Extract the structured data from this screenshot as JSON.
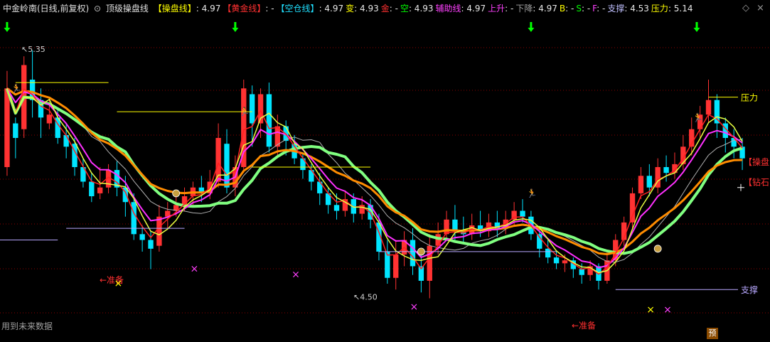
{
  "header": {
    "stock_name": "中金岭南(日线,前复权)",
    "indicator_name": "顶级操盘线",
    "items": [
      {
        "label": "【操盘线】",
        "value": ": 4.97",
        "color": "#ffff00"
      },
      {
        "label": "【黄金线】",
        "value": ": -",
        "color": "#ff3030"
      },
      {
        "label": "【空仓线】",
        "value": ": 4.97",
        "color": "#20e0ff"
      },
      {
        "label": "变",
        "value": ": 4.93",
        "color": "#ffff00"
      },
      {
        "label": "金",
        "value": ": -",
        "color": "#ff3030"
      },
      {
        "label": "空",
        "value": ": 4.93",
        "color": "#00ff00"
      },
      {
        "label": "辅助线",
        "value": ": 4.97",
        "color": "#ff40ff"
      },
      {
        "label": "上升",
        "value": ": -",
        "color": "#ff40ff"
      },
      {
        "label": "下降",
        "value": ": 4.97",
        "color": "#a0a0a0"
      },
      {
        "label": "B",
        "value": ": -",
        "color": "#ffff00"
      },
      {
        "label": "S",
        "value": ": -",
        "color": "#00ff00"
      },
      {
        "label": "F",
        "value": ": -",
        "color": "#ff40ff"
      },
      {
        "label": "支撑",
        "value": ": 4.53",
        "color": "#c0c0ff"
      },
      {
        "label": "压力",
        "value": ": 5.14",
        "color": "#ffff00"
      }
    ],
    "settings_icon": "diamond-icon",
    "close_icon": "close-icon"
  },
  "footer_note": "用到未来数据",
  "badge": "预",
  "colors": {
    "up": "#ff3232",
    "down": "#00e5ff",
    "ma_thin": "#ff2020",
    "ma_pink": "#ff30ff",
    "ma_orange": "#ff8c00",
    "ma_green": "#80ff80",
    "ma_yellow": "#e8ff40",
    "ma_gray": "#b0b0b0",
    "support": "#b8a8ff",
    "resistance": "#ffff00",
    "grid": "#8b0000"
  },
  "chart_data": {
    "type": "candlestick",
    "y_range": [
      4.45,
      5.45
    ],
    "annotations": {
      "high_label": "5.35",
      "low_label": "4.50",
      "prepare_label": "←准备",
      "resistance_label": "压力",
      "support_label": "支撑",
      "right_labels": [
        "【操盘",
        "【钻石"
      ]
    },
    "candles": [
      [
        4.95,
        5.22,
        5.28,
        4.92
      ],
      [
        5.1,
        5.05,
        5.12,
        4.98
      ],
      [
        5.08,
        5.3,
        5.33,
        5.05
      ],
      [
        5.25,
        5.18,
        5.35,
        5.12
      ],
      [
        5.18,
        5.12,
        5.22,
        5.05
      ],
      [
        5.1,
        5.13,
        5.18,
        5.08
      ],
      [
        5.12,
        5.05,
        5.15,
        5.03
      ],
      [
        5.06,
        5.02,
        5.1,
        4.98
      ],
      [
        5.03,
        4.95,
        5.05,
        4.92
      ],
      [
        4.95,
        4.9,
        4.98,
        4.88
      ],
      [
        4.9,
        4.85,
        4.93,
        4.83
      ],
      [
        4.86,
        4.88,
        4.95,
        4.84
      ],
      [
        4.88,
        4.94,
        4.96,
        4.86
      ],
      [
        4.94,
        4.88,
        4.97,
        4.85
      ],
      [
        4.88,
        4.83,
        4.92,
        4.78
      ],
      [
        4.83,
        4.72,
        4.86,
        4.7
      ],
      [
        4.72,
        4.7,
        4.75,
        4.66
      ],
      [
        4.7,
        4.67,
        4.73,
        4.6
      ],
      [
        4.68,
        4.78,
        4.82,
        4.66
      ],
      [
        4.78,
        4.8,
        4.83,
        4.74
      ],
      [
        4.8,
        4.82,
        4.86,
        4.78
      ],
      [
        4.82,
        4.85,
        4.88,
        4.8
      ],
      [
        4.85,
        4.88,
        4.9,
        4.82
      ],
      [
        4.88,
        4.86,
        4.92,
        4.83
      ],
      [
        4.86,
        4.9,
        4.94,
        4.84
      ],
      [
        4.9,
        5.05,
        5.1,
        4.88
      ],
      [
        5.03,
        4.88,
        5.08,
        4.86
      ],
      [
        4.88,
        4.95,
        4.99,
        4.85
      ],
      [
        4.95,
        5.22,
        5.25,
        4.93
      ],
      [
        5.2,
        5.1,
        5.23,
        5.02
      ],
      [
        5.1,
        5.2,
        5.22,
        5.05
      ],
      [
        5.2,
        5.02,
        5.24,
        5.0
      ],
      [
        5.02,
        5.09,
        5.13,
        4.98
      ],
      [
        5.09,
        5.04,
        5.11,
        4.99
      ],
      [
        5.03,
        4.98,
        5.06,
        4.96
      ],
      [
        4.98,
        4.94,
        5.0,
        4.91
      ],
      [
        4.94,
        4.9,
        4.96,
        4.87
      ],
      [
        4.9,
        4.86,
        4.93,
        4.82
      ],
      [
        4.86,
        4.82,
        4.88,
        4.79
      ],
      [
        4.82,
        4.8,
        4.86,
        4.77
      ],
      [
        4.8,
        4.84,
        4.87,
        4.78
      ],
      [
        4.84,
        4.79,
        4.86,
        4.76
      ],
      [
        4.79,
        4.82,
        4.85,
        4.77
      ],
      [
        4.82,
        4.77,
        4.84,
        4.74
      ],
      [
        4.76,
        4.66,
        4.79,
        4.63
      ],
      [
        4.66,
        4.57,
        4.7,
        4.55
      ],
      [
        4.57,
        4.65,
        4.7,
        4.53
      ],
      [
        4.65,
        4.7,
        4.73,
        4.61
      ],
      [
        4.7,
        4.61,
        4.74,
        4.58
      ],
      [
        4.61,
        4.56,
        4.65,
        4.52
      ],
      [
        4.56,
        4.68,
        4.72,
        4.5
      ],
      [
        4.68,
        4.72,
        4.76,
        4.65
      ],
      [
        4.72,
        4.77,
        4.8,
        4.7
      ],
      [
        4.77,
        4.73,
        4.82,
        4.7
      ],
      [
        4.73,
        4.72,
        4.78,
        4.69
      ],
      [
        4.72,
        4.75,
        4.79,
        4.7
      ],
      [
        4.75,
        4.73,
        4.8,
        4.71
      ],
      [
        4.73,
        4.76,
        4.79,
        4.71
      ],
      [
        4.76,
        4.74,
        4.8,
        4.71
      ],
      [
        4.74,
        4.77,
        4.8,
        4.72
      ],
      [
        4.77,
        4.8,
        4.83,
        4.75
      ],
      [
        4.8,
        4.78,
        4.84,
        4.76
      ],
      [
        4.78,
        4.72,
        4.8,
        4.7
      ],
      [
        4.72,
        4.67,
        4.74,
        4.64
      ],
      [
        4.67,
        4.64,
        4.7,
        4.62
      ],
      [
        4.64,
        4.62,
        4.66,
        4.6
      ],
      [
        4.62,
        4.63,
        4.65,
        4.59
      ],
      [
        4.63,
        4.6,
        4.64,
        4.57
      ],
      [
        4.6,
        4.58,
        4.62,
        4.55
      ],
      [
        4.58,
        4.61,
        4.63,
        4.56
      ],
      [
        4.61,
        4.56,
        4.62,
        4.53
      ],
      [
        4.56,
        4.63,
        4.66,
        4.55
      ],
      [
        4.63,
        4.7,
        4.72,
        4.61
      ],
      [
        4.7,
        4.76,
        4.78,
        4.68
      ],
      [
        4.76,
        4.86,
        4.88,
        4.74
      ],
      [
        4.86,
        4.92,
        4.95,
        4.84
      ],
      [
        4.92,
        4.88,
        4.96,
        4.85
      ],
      [
        4.88,
        4.95,
        4.98,
        4.86
      ],
      [
        4.95,
        4.93,
        4.99,
        4.9
      ],
      [
        4.93,
        4.96,
        5.0,
        4.91
      ],
      [
        4.96,
        5.02,
        5.06,
        4.94
      ],
      [
        5.02,
        5.08,
        5.12,
        4.99
      ],
      [
        5.08,
        5.13,
        5.16,
        5.05
      ],
      [
        5.13,
        5.18,
        5.25,
        5.1
      ],
      [
        5.18,
        5.1,
        5.2,
        5.05
      ],
      [
        5.1,
        5.05,
        5.12,
        5.0
      ],
      [
        5.05,
        5.02,
        5.08,
        4.98
      ],
      [
        5.02,
        4.98,
        5.05,
        4.94
      ]
    ],
    "levels": {
      "resistance_1": 5.24,
      "resistance_2": 5.14,
      "resistance_3": 4.95,
      "support_1": 4.76,
      "support_2": 4.66,
      "support_3": 4.53
    }
  }
}
